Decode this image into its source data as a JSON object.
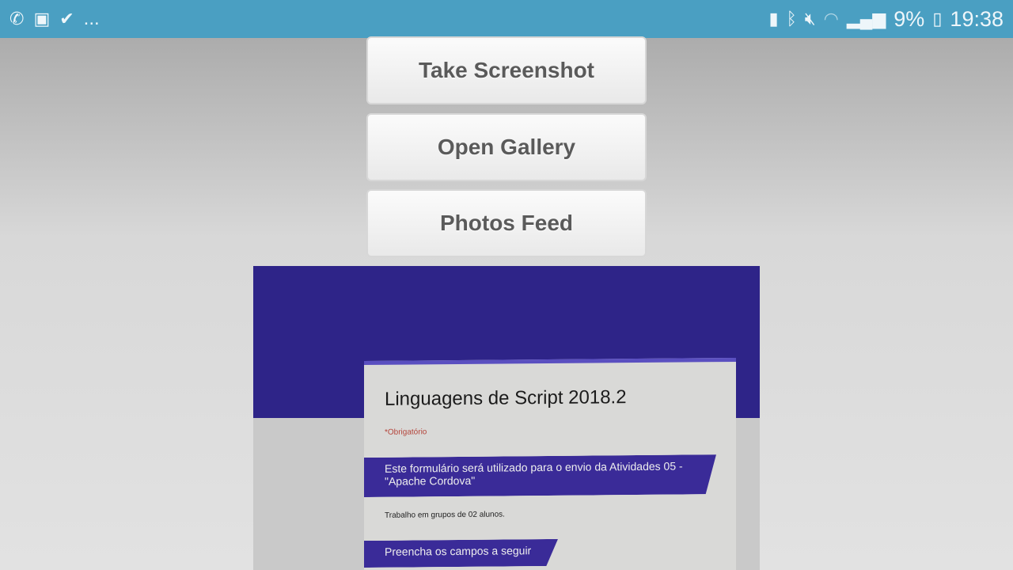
{
  "status_bar": {
    "left_icons": [
      "whatsapp-icon",
      "gallery-icon",
      "check-icon"
    ],
    "more": "...",
    "right_icons": [
      "battery-saver-icon",
      "bluetooth-icon",
      "mute-icon",
      "wifi-icon",
      "signal-icon"
    ],
    "battery_percent": "9%",
    "time": "19:38"
  },
  "buttons": {
    "take_screenshot": "Take Screenshot",
    "open_gallery": "Open Gallery",
    "photos_feed": "Photos Feed"
  },
  "photo": {
    "title": "Linguagens de Script 2018.2",
    "required": "*Obrigatório",
    "banner1": "Este formulário será utilizado para o envio da Atividades 05 - \"Apache Cordova\"",
    "note": "Trabalho em grupos de 02 alunos.",
    "banner2": "Preencha os campos a seguir"
  }
}
